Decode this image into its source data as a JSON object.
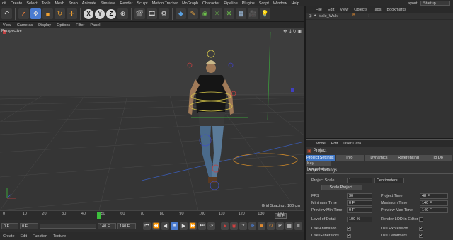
{
  "menubar": {
    "items": [
      "dit",
      "Create",
      "Select",
      "Tools",
      "Mesh",
      "Snap",
      "Animate",
      "Simulate",
      "Render",
      "Sculpt",
      "Motion Tracker",
      "MoGraph",
      "Character",
      "Pipeline",
      "Plugins",
      "Script",
      "Window",
      "Help"
    ],
    "layout_label": "Layout:",
    "layout_value": "Startup"
  },
  "toolbar": {
    "axis_x": "X",
    "axis_y": "Y",
    "axis_z": "Z"
  },
  "viewport_menu": [
    "View",
    "Cameras",
    "Display",
    "Options",
    "Filter",
    "Panel"
  ],
  "viewport": {
    "label": "Perspective",
    "grid_spacing": "Grid Spacing : 100 cm"
  },
  "timeline": {
    "ticks": [
      "0",
      "10",
      "20",
      "30",
      "40",
      "50",
      "60",
      "70",
      "80",
      "90",
      "100",
      "110",
      "120",
      "130",
      "140"
    ],
    "end_frame": "48 F"
  },
  "transport": {
    "current_frame": "0 F",
    "min_frame": "0 F",
    "max_frame": "140 F",
    "end_frame": "140 F"
  },
  "material_menu": [
    "Create",
    "Edit",
    "Function",
    "Texture"
  ],
  "object_manager": {
    "menu": [
      "File",
      "Edit",
      "View",
      "Objects",
      "Tags",
      "Bookmarks"
    ],
    "objects": [
      {
        "name": "Male_Walk"
      }
    ]
  },
  "attributes": {
    "menu": [
      "Mode",
      "Edit",
      "User Data"
    ],
    "title": "Project",
    "tabs": [
      "Project Settings",
      "Info",
      "Dynamics",
      "Referencing",
      "To Do"
    ],
    "active_tab": "Project Settings",
    "subtab": "Key Interpolation",
    "section": "Project Settings",
    "project_scale_label": "Project Scale",
    "project_scale_value": "1",
    "project_scale_unit": "Centimeters",
    "scale_button": "Scale Project...",
    "fps_label": "FPS",
    "fps_value": "30",
    "project_time_label": "Project Time",
    "project_time_value": "48 F",
    "min_time_label": "Minimum Time",
    "min_time_value": "0 F",
    "max_time_label": "Maximum Time",
    "max_time_value": "140 F",
    "preview_min_label": "Preview Min Time",
    "preview_min_value": "0 F",
    "preview_max_label": "Preview Max Time",
    "preview_max_value": "140 F",
    "lod_label": "Level of Detail",
    "lod_value": "100 %",
    "render_lod_label": "Render LOD in Editor",
    "use_animation_label": "Use Animation",
    "use_expression_label": "Use Expression",
    "use_generators_label": "Use Generators",
    "use_deformers_label": "Use Deformers"
  }
}
